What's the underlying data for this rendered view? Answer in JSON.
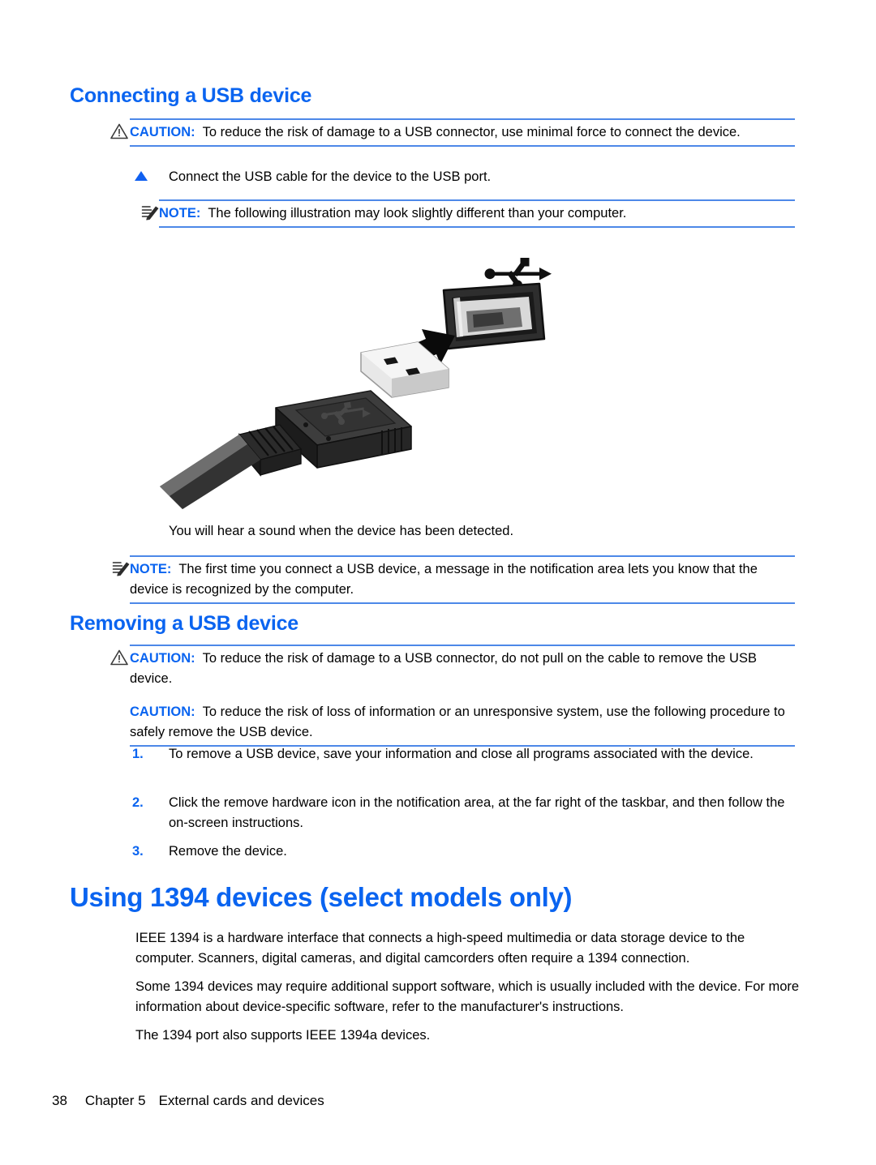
{
  "colors": {
    "heading_blue": "#0a64f0",
    "rule_blue": "#4d88e8",
    "bullet_blue": "#1060f0",
    "text_black": "#000000",
    "page_background": "#ffffff"
  },
  "sections": {
    "connecting": {
      "heading": "Connecting a USB device",
      "caution": {
        "label": "CAUTION:",
        "text": "To reduce the risk of damage to a USB connector, use minimal force to connect the device.",
        "icon": "caution-triangle-icon"
      },
      "step": {
        "bullet": "blue-triangle-bullet",
        "text": "Connect the USB cable for the device to the USB port."
      },
      "note_before_image": {
        "label": "NOTE:",
        "text": "The following illustration may look slightly different than your computer.",
        "icon": "note-pencil-icon"
      },
      "illustration": {
        "name": "usb-cable-into-port-illustration",
        "alt": "A USB Type-A cable plug with an arrow pointing toward a USB port on a computer, with the USB trident symbol above the port"
      },
      "after_image_text": "You will hear a sound when the device has been detected.",
      "note_after_image": {
        "label": "NOTE:",
        "text": "The first time you connect a USB device, a message in the notification area lets you know that the device is recognized by the computer.",
        "icon": "note-pencil-icon"
      }
    },
    "removing": {
      "heading": "Removing a USB device",
      "caution1": {
        "label": "CAUTION:",
        "text": "To reduce the risk of damage to a USB connector, do not pull on the cable to remove the USB device.",
        "icon": "caution-triangle-icon"
      },
      "caution2": {
        "label": "CAUTION:",
        "text": "To reduce the risk of loss of information or an unresponsive system, use the following procedure to safely remove the USB device."
      },
      "steps": [
        {
          "number": "1.",
          "text": "To remove a USB device, save your information and close all programs associated with the device."
        },
        {
          "number": "2.",
          "text": "Click the remove hardware icon in the notification area, at the far right of the taskbar, and then follow the on-screen instructions."
        },
        {
          "number": "3.",
          "text": "Remove the device."
        }
      ]
    },
    "using1394": {
      "heading": "Using 1394 devices (select models only)",
      "paragraphs": [
        "IEEE 1394 is a hardware interface that connects a high-speed multimedia or data storage device to the computer. Scanners, digital cameras, and digital camcorders often require a 1394 connection.",
        "Some 1394 devices may require additional support software, which is usually included with the device. For more information about device-specific software, refer to the manufacturer's instructions.",
        "The 1394 port also supports IEEE 1394a devices."
      ]
    }
  },
  "footer": {
    "page_number": "38",
    "chapter": "Chapter 5",
    "chapter_title": "External cards and devices"
  }
}
